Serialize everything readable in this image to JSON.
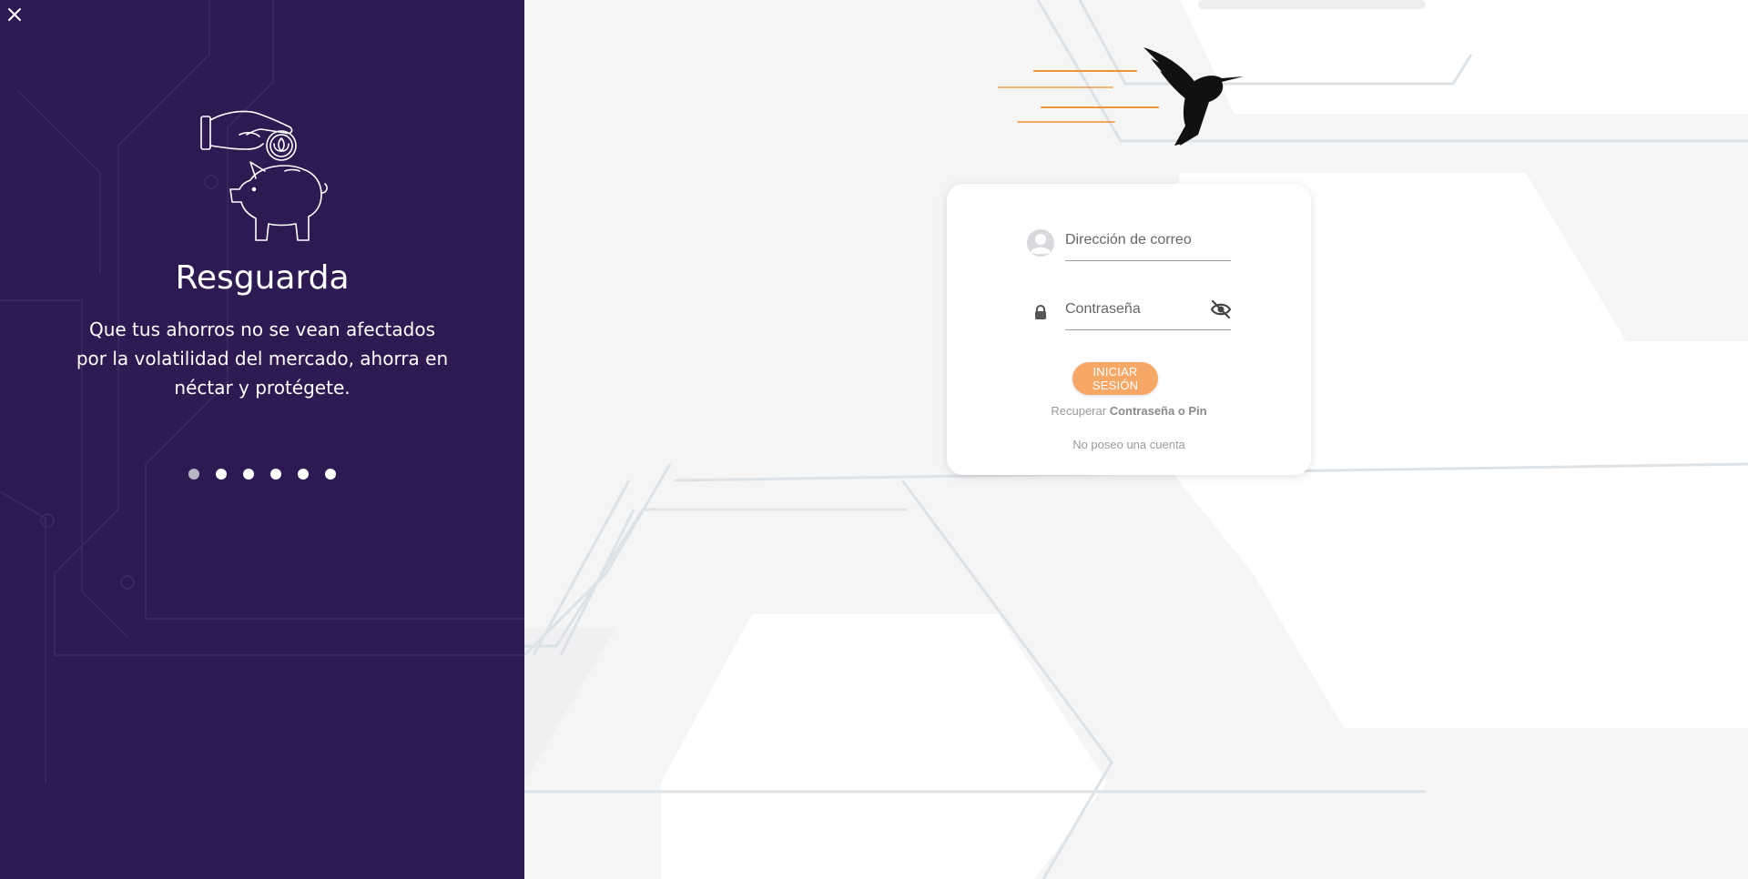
{
  "carousel": {
    "close_icon": "close-icon",
    "illustration": "hand-coin-piggy-bank-icon",
    "title": "Resguarda",
    "text": "Que tus ahorros no se vean afectados por la volatilidad del mercado, ahorra en néctar y protégete.",
    "dots_total": 6,
    "active_dot": 1
  },
  "logo": {
    "icon": "hummingbird-logo"
  },
  "login": {
    "email_placeholder": "Dirección de correo",
    "email_icon": "user-avatar-icon",
    "password_placeholder": "Contraseña",
    "password_icon": "lock-icon",
    "password_toggle_icon": "eye-off-icon",
    "submit_label": "INICIAR SESIÓN",
    "recover_prefix": "Recuperar",
    "recover_link": "Contraseña o Pin",
    "no_account": "No poseo una cuenta"
  },
  "colors": {
    "panel": "#2e1a52",
    "accent": "#f7a867",
    "background": "#f5f5f6",
    "logo_streaks": "#f18a1e"
  }
}
